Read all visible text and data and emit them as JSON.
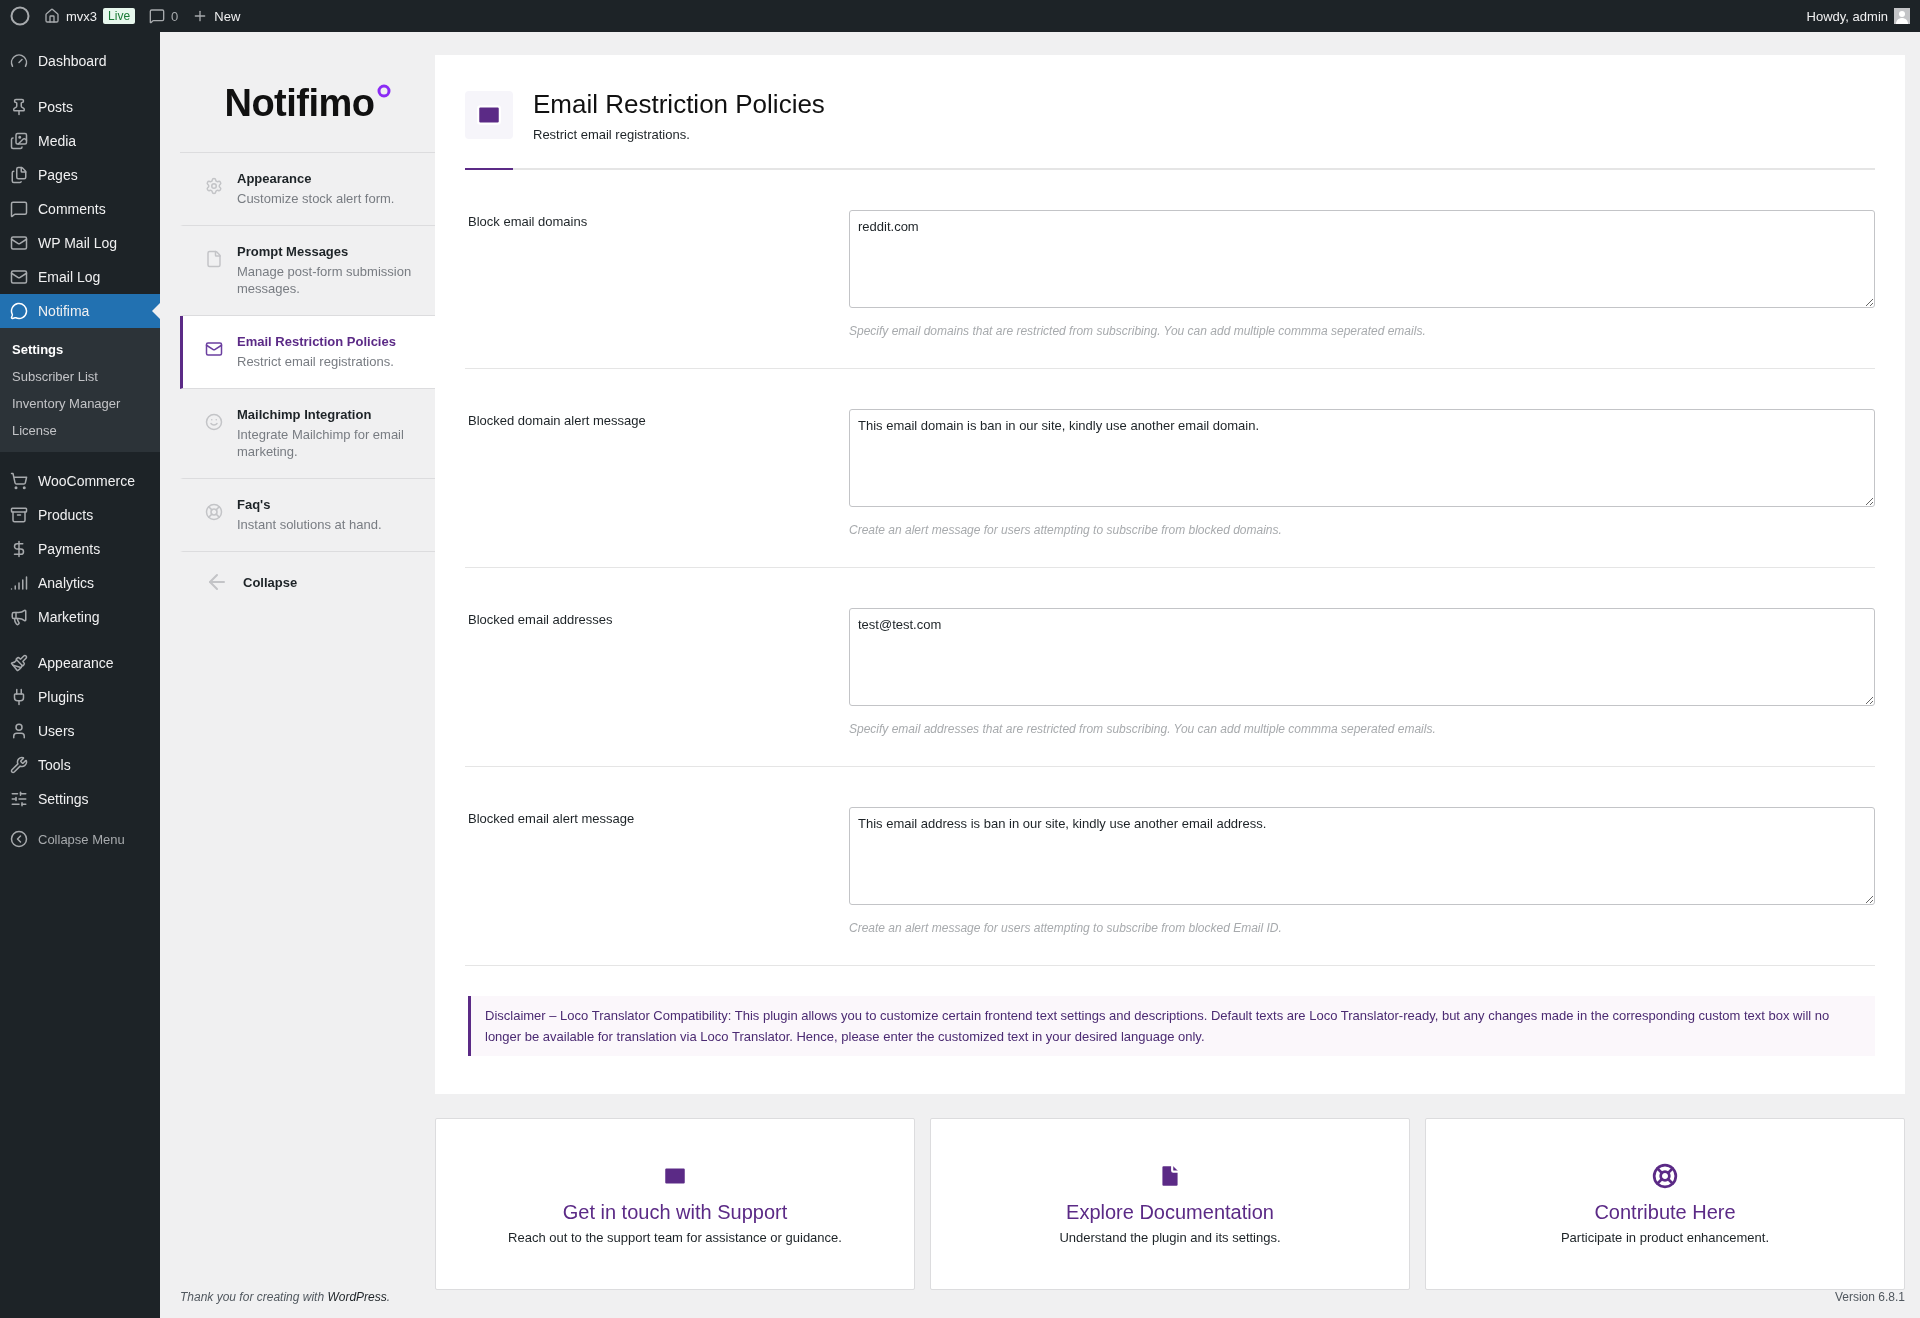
{
  "admin_bar": {
    "site_name": "mvx3",
    "live_badge": "Live",
    "comments_count": "0",
    "new_label": "New",
    "greeting": "Howdy, admin"
  },
  "admin_menu": {
    "sections": [
      [
        {
          "kind": "dashboard",
          "label": "Dashboard",
          "selected": false
        }
      ],
      [
        {
          "kind": "pin",
          "label": "Posts",
          "selected": false
        },
        {
          "kind": "media",
          "label": "Media",
          "selected": false
        },
        {
          "kind": "pages",
          "label": "Pages",
          "selected": false
        },
        {
          "kind": "comment",
          "label": "Comments",
          "selected": false
        },
        {
          "kind": "mail",
          "label": "WP Mail Log",
          "selected": false
        },
        {
          "kind": "mail",
          "label": "Email Log",
          "selected": false
        },
        {
          "kind": "chat",
          "label": "Notifima",
          "selected": true,
          "children": [
            {
              "label": "Settings",
              "selected": true
            },
            {
              "label": "Subscriber List",
              "selected": false
            },
            {
              "label": "Inventory Manager",
              "selected": false
            },
            {
              "label": "License",
              "selected": false
            }
          ]
        }
      ],
      [
        {
          "kind": "woo",
          "label": "WooCommerce",
          "selected": false
        },
        {
          "kind": "archive",
          "label": "Products",
          "selected": false
        },
        {
          "kind": "dollar",
          "label": "Payments",
          "selected": false
        },
        {
          "kind": "bars",
          "label": "Analytics",
          "selected": false
        },
        {
          "kind": "megaphone",
          "label": "Marketing",
          "selected": false
        }
      ],
      [
        {
          "kind": "brush",
          "label": "Appearance",
          "selected": false
        },
        {
          "kind": "plug",
          "label": "Plugins",
          "selected": false
        },
        {
          "kind": "user",
          "label": "Users",
          "selected": false
        },
        {
          "kind": "wrench",
          "label": "Tools",
          "selected": false
        },
        {
          "kind": "sliders",
          "label": "Settings",
          "selected": false
        }
      ]
    ],
    "collapse_label": "Collapse Menu"
  },
  "plugin_nav": {
    "logo": "Notifimo",
    "items": [
      {
        "kind": "gear",
        "title": "Appearance",
        "description": "Customize stock alert form.",
        "selected": false
      },
      {
        "kind": "doc",
        "title": "Prompt Messages",
        "description": "Manage post-form submission messages.",
        "selected": false
      },
      {
        "kind": "mail",
        "title": "Email Restriction Policies",
        "description": "Restrict email registrations.",
        "selected": true
      },
      {
        "kind": "chimp",
        "title": "Mailchimp Integration",
        "description": "Integrate Mailchimp for email marketing.",
        "selected": false
      },
      {
        "kind": "buoy",
        "title": "Faq's",
        "description": "Instant solutions at hand.",
        "selected": false
      }
    ],
    "collapse_label": "Collapse"
  },
  "page": {
    "title": "Email Restriction Policies",
    "subtitle": "Restrict email registrations.",
    "fields": [
      {
        "label": "Block email domains",
        "value": "reddit.com",
        "hint": "Specify email domains that are restricted from subscribing. You can add multiple commma seperated emails."
      },
      {
        "label": "Blocked domain alert message",
        "value": "This email domain is ban in our site, kindly use another email domain.",
        "hint": "Create an alert message for users attempting to subscribe from blocked domains."
      },
      {
        "label": "Blocked email addresses",
        "value": "test@test.com",
        "hint": "Specify email addresses that are restricted from subscribing. You can add multiple commma seperated emails."
      },
      {
        "label": "Blocked email alert message",
        "value": "This email address is ban in our site, kindly use another email address.",
        "hint": "Create an alert message for users attempting to subscribe from blocked Email ID."
      }
    ],
    "disclaimer": "Disclaimer – Loco Translator Compatibility: This plugin allows you to customize certain frontend text settings and descriptions. Default texts are Loco Translator-ready, but any changes made in the corresponding custom text box will no longer be available for translation via Loco Translator. Hence, please enter the customized text in your desired language only."
  },
  "cards": [
    {
      "kind": "mail",
      "title": "Get in touch with Support",
      "description": "Reach out to the support team for assistance or guidance."
    },
    {
      "kind": "doc",
      "title": "Explore Documentation",
      "description": "Understand the plugin and its settings."
    },
    {
      "kind": "buoy",
      "title": "Contribute Here",
      "description": "Participate in product enhancement."
    }
  ],
  "footer": {
    "text": "Thank you for creating with",
    "link": "WordPress",
    "end": ".",
    "version": "Version 6.8.1"
  }
}
